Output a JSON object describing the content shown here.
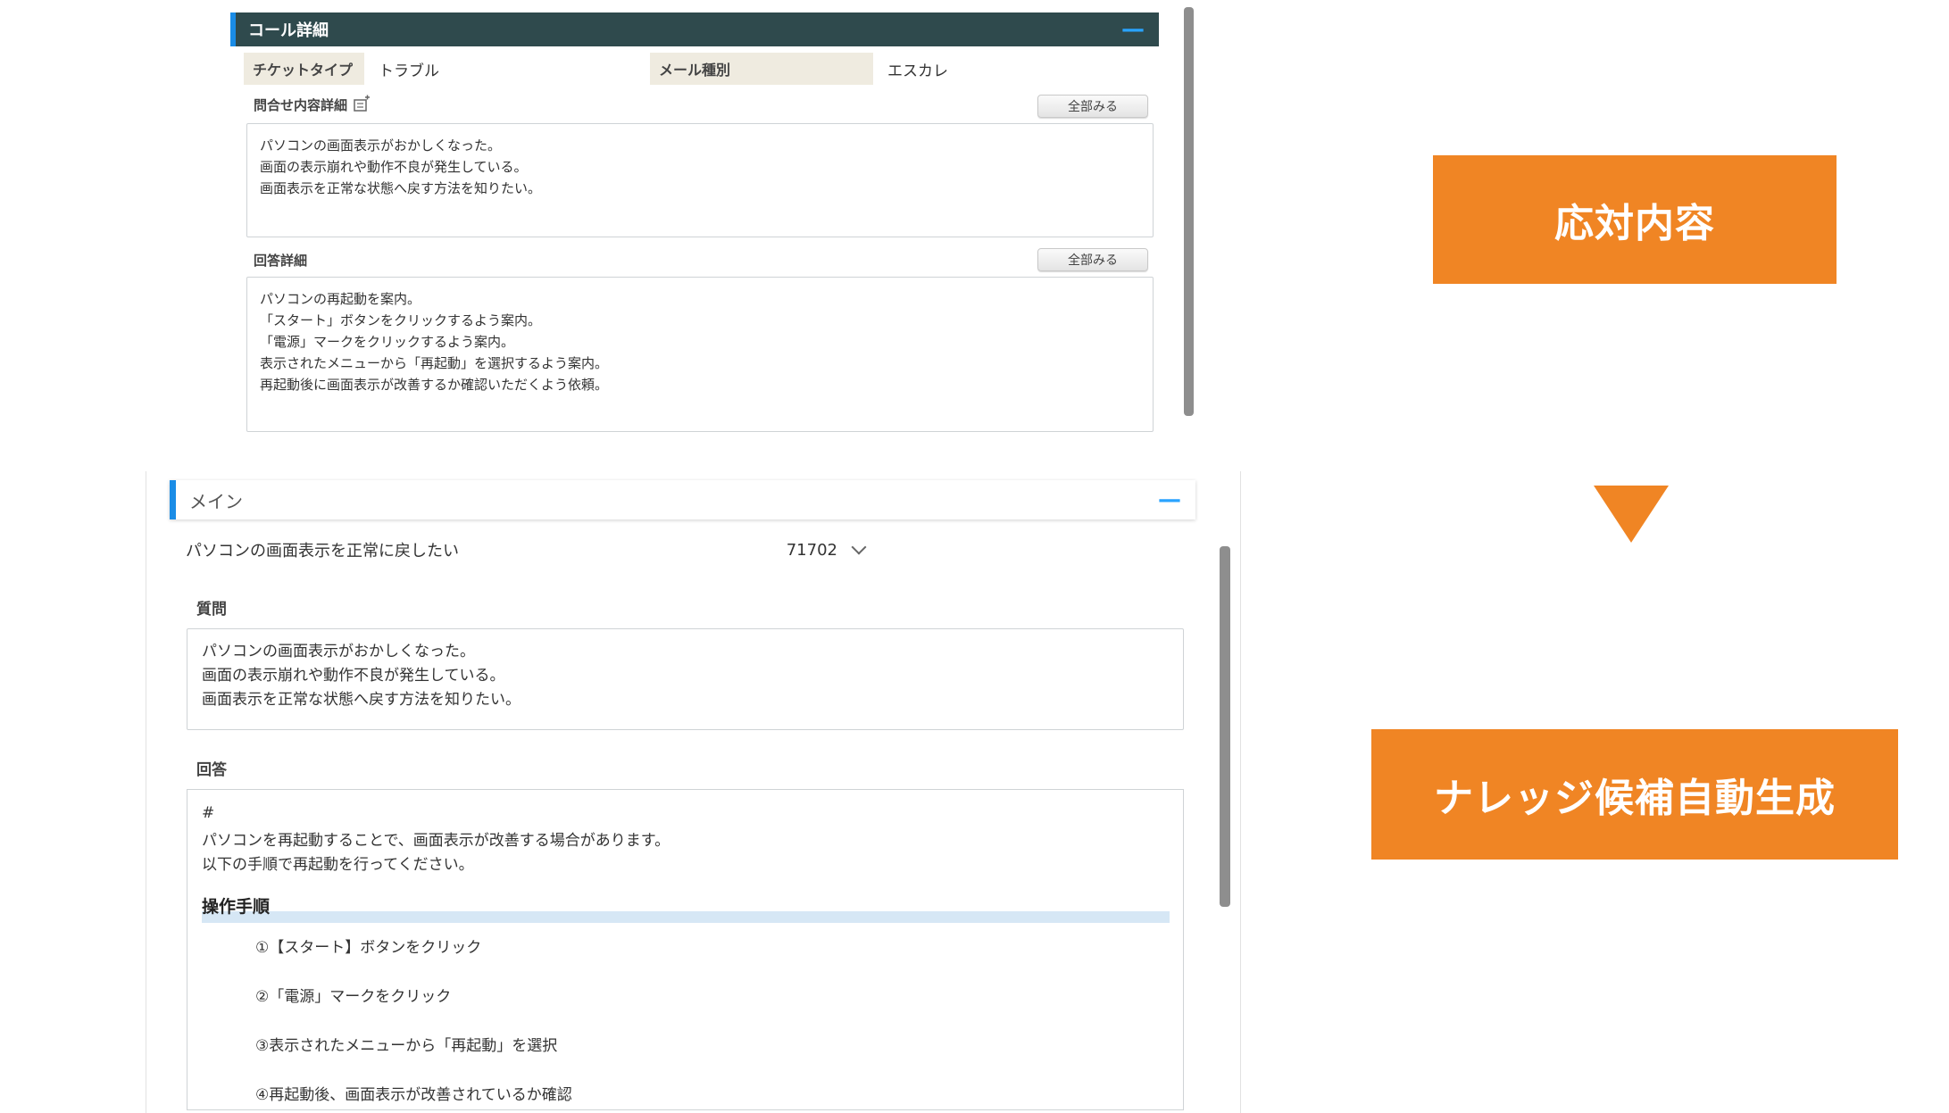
{
  "call_detail": {
    "title": "コール詳細",
    "collapse_symbol": "—",
    "ticket_type_label": "チケットタイプ",
    "ticket_type_value": "トラブル",
    "mail_type_label": "メール種別",
    "mail_type_value": "エスカレ",
    "inquiry_label": "問合せ内容詳細",
    "inquiry_show_all": "全部みる",
    "inquiry_lines": [
      "パソコンの画面表示がおかしくなった。",
      "画面の表示崩れや動作不良が発生している。",
      "画面表示を正常な状態へ戻す方法を知りたい。"
    ],
    "answer_label": "回答詳細",
    "answer_show_all": "全部みる",
    "answer_lines": [
      "パソコンの再起動を案内。",
      "「スタート」ボタンをクリックするよう案内。",
      "「電源」マークをクリックするよう案内。",
      "表示されたメニューから「再起動」を選択するよう案内。",
      "再起動後に画面表示が改善するか確認いただくよう依頼。"
    ]
  },
  "main": {
    "title": "メイン",
    "collapse_symbol": "—",
    "knowledge_title": "パソコンの画面表示を正常に戻したい",
    "knowledge_id": "71702",
    "question_label": "質問",
    "question_lines": [
      "パソコンの画面表示がおかしくなった。",
      "画面の表示崩れや動作不良が発生している。",
      "画面表示を正常な状態へ戻す方法を知りたい。"
    ],
    "answer_label": "回答",
    "answer_hash": "#",
    "answer_lines": [
      "パソコンを再起動することで、画面表示が改善する場合があります。",
      "以下の手順で再起動を行ってください。"
    ],
    "steps_heading": "操作手順",
    "steps": [
      "①【スタート】ボタンをクリック",
      "②「電源」マークをクリック",
      "③表示されたメニューから「再起動」を選択",
      "④再起動後、画面表示が改善されているか確認"
    ]
  },
  "labels": {
    "response_content": "応対内容",
    "auto_generate": "ナレッジ候補自動生成"
  },
  "colors": {
    "orange": "#f08524",
    "header_dark": "#2f4a4d",
    "accent_blue": "#1a8ce6"
  }
}
